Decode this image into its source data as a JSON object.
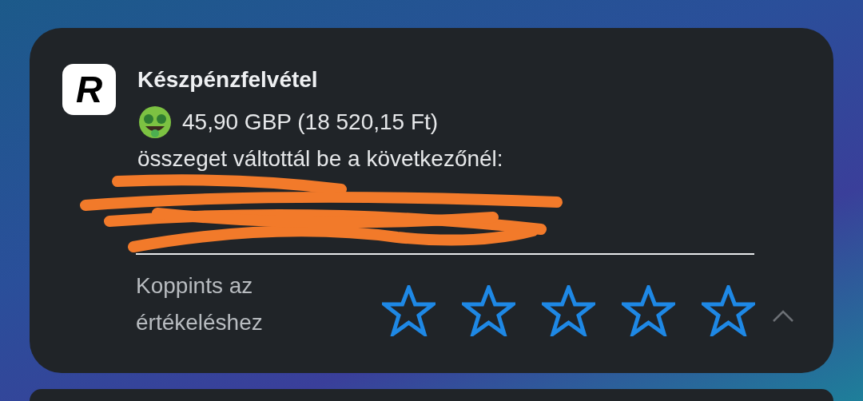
{
  "notification": {
    "app_logo": "R",
    "title": "Készpénzfelvétel",
    "amount": "45,90 GBP (18 520,15 Ft)",
    "body": "összeget váltottál be a következőnél:",
    "rating_prompt": "Koppints az értékeléshez",
    "stars": 0,
    "expanded": true
  }
}
